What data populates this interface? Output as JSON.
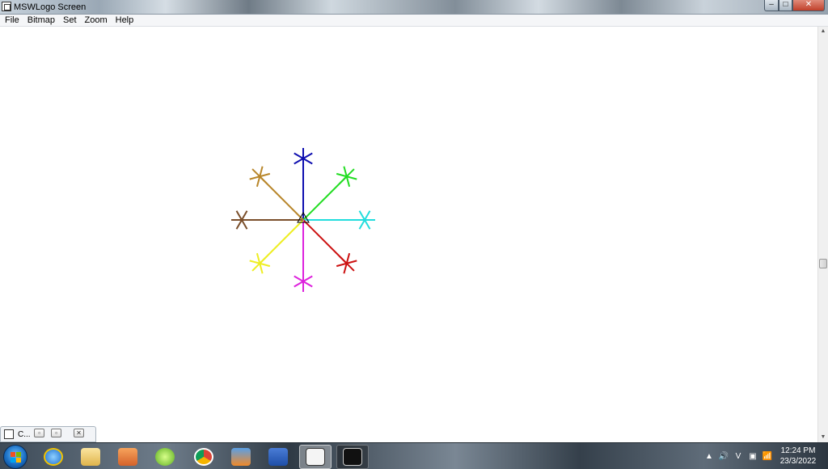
{
  "window": {
    "title": "MSWLogo Screen",
    "controls": {
      "minimize": "–",
      "maximize": "□",
      "close": "✕"
    }
  },
  "menubar": {
    "items": [
      "File",
      "Bitmap",
      "Set",
      "Zoom",
      "Help"
    ]
  },
  "canvas": {
    "spokes": [
      {
        "color": "#1010b0"
      },
      {
        "color": "#22dd22"
      },
      {
        "color": "#22dddd"
      },
      {
        "color": "#cc1111"
      },
      {
        "color": "#dd22dd"
      },
      {
        "color": "#eeee22"
      },
      {
        "color": "#7a4e2a"
      },
      {
        "color": "#b8862a"
      }
    ]
  },
  "minimized_commander": {
    "label": "C..."
  },
  "taskbar": {
    "apps": [
      {
        "name": "internet-explorer"
      },
      {
        "name": "file-explorer"
      },
      {
        "name": "media-player"
      },
      {
        "name": "green-app"
      },
      {
        "name": "chrome"
      },
      {
        "name": "education-app"
      },
      {
        "name": "word"
      },
      {
        "name": "mswlogo",
        "active": true
      },
      {
        "name": "command-prompt"
      }
    ],
    "tray": {
      "icons": [
        "▲",
        "🔊",
        "V",
        "▣",
        "📶"
      ]
    },
    "clock": {
      "time": "12:24 PM",
      "date": "23/3/2022"
    }
  }
}
